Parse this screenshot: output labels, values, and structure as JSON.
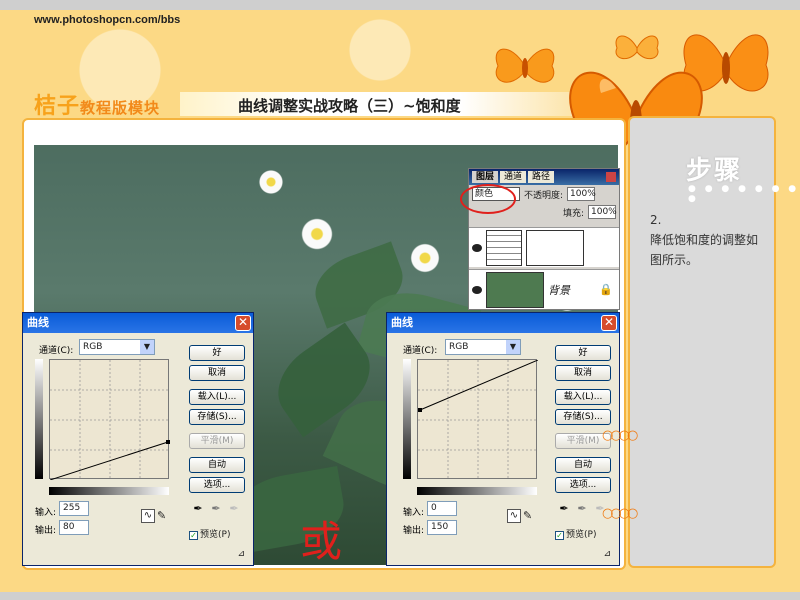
{
  "site_url": "www.photoshopcn.com/bbs",
  "brand": {
    "main": "桔子",
    "sub": "教程版模块"
  },
  "title": "曲线调整实战攻略（三）~饱和度",
  "layers_panel": {
    "tabs": [
      "图层",
      "通道",
      "路径"
    ],
    "mode": "颜色",
    "opacity_label": "不透明度:",
    "opacity_value": "100%",
    "fill_label": "填充:",
    "fill_value": "100%",
    "background_layer": "背景"
  },
  "curves_left": {
    "title": "曲线",
    "channel_label": "通道(C):",
    "channel_value": "RGB",
    "buttons": {
      "ok": "好",
      "cancel": "取消",
      "load": "载入(L)...",
      "save": "存储(S)...",
      "smooth": "平滑(M)",
      "auto": "自动",
      "options": "选项..."
    },
    "input_label": "输入:",
    "input_value": "255",
    "output_label": "输出:",
    "output_value": "80",
    "preview_label": "预览(P)"
  },
  "curves_right": {
    "title": "曲线",
    "channel_label": "通道(C):",
    "channel_value": "RGB",
    "buttons": {
      "ok": "好",
      "cancel": "取消",
      "load": "载入(L)...",
      "save": "存储(S)...",
      "smooth": "平滑(M)",
      "auto": "自动",
      "options": "选项..."
    },
    "input_label": "输入:",
    "input_value": "0",
    "output_label": "输出:",
    "output_value": "150",
    "preview_label": "预览(P)"
  },
  "or_text": "或",
  "steps": {
    "title": "步骤",
    "number": "2.",
    "text": "降低饱和度的调整如图所示。"
  },
  "colors": {
    "accent": "#f4b33e",
    "brand_orange": "#f7a21b",
    "highlight_red": "#e0201c",
    "xp_title": "#0a5cd8"
  }
}
